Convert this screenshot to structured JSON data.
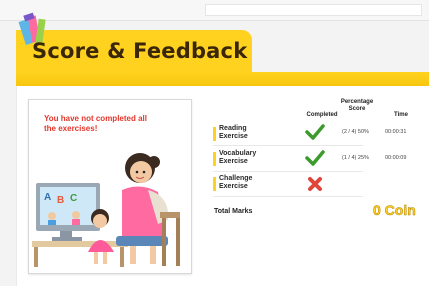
{
  "header": {
    "title": "Score & Feedback"
  },
  "message": "You have not completed all the exercises!",
  "table": {
    "columns": {
      "completed": "Completed",
      "score": "Percentage Score",
      "time": "Time"
    },
    "rows": [
      {
        "name": "Reading Exercise",
        "status": "completed",
        "score": "(2 / 4) 50%",
        "time": "00:00:31"
      },
      {
        "name": "Vocabulary Exercise",
        "status": "completed",
        "score": "(1 / 4) 25%",
        "time": "00:00:09"
      },
      {
        "name": "Challenge Exercise",
        "status": "not-completed",
        "score": "",
        "time": ""
      }
    ]
  },
  "total": {
    "label": "Total Marks",
    "value": "0 Coin"
  },
  "colors": {
    "accent": "#ffd21f",
    "check": "#3c9b2c",
    "cross": "#e0453a",
    "message": "#e4362b"
  },
  "icons": {
    "completed": "check-icon",
    "not_completed": "cross-icon",
    "header": "pencil-icon"
  }
}
